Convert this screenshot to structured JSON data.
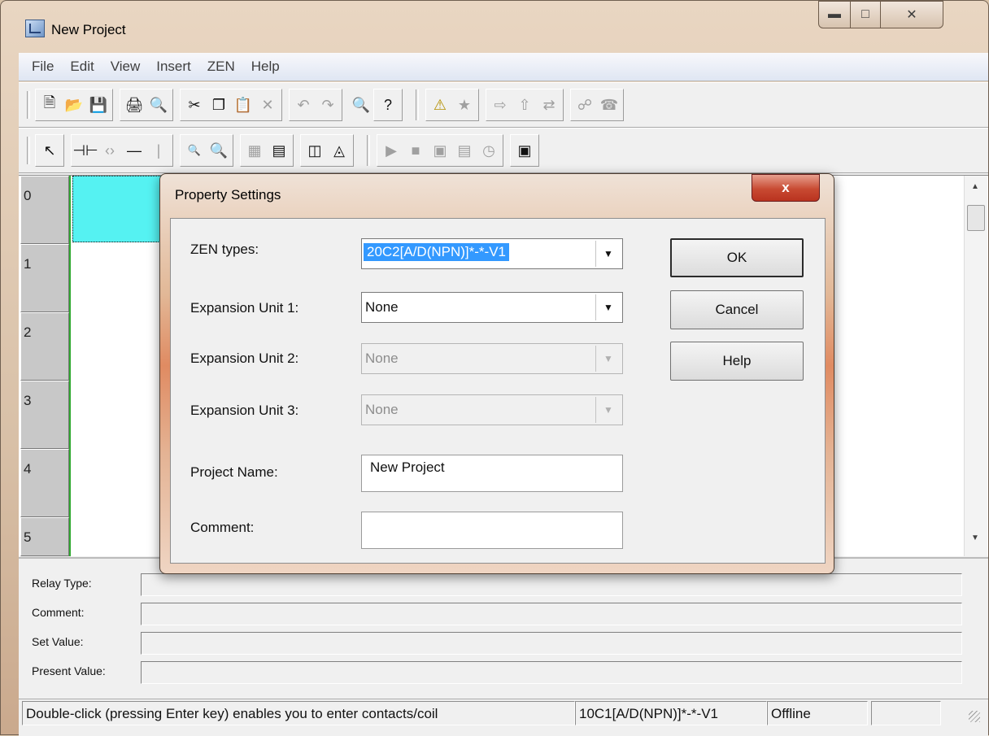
{
  "window": {
    "title": "New Project",
    "min_icon": "minimize-icon",
    "max_icon": "maximize-icon",
    "close_icon": "close-icon"
  },
  "menu": [
    "File",
    "Edit",
    "View",
    "Insert",
    "ZEN",
    "Help"
  ],
  "rows": [
    "0",
    "1",
    "2",
    "3",
    "4",
    "5"
  ],
  "info": {
    "relay_type": "Relay Type:",
    "comment": "Comment:",
    "set_value": "Set Value:",
    "present_value": "Present Value:"
  },
  "status": {
    "hint": "Double-click (pressing Enter key) enables you to enter contacts/coil",
    "type": "10C1[A/D(NPN)]*-*-V1",
    "mode": "Offline"
  },
  "dialog": {
    "title": "Property Settings",
    "close_label": "x",
    "zen_types_label": "ZEN types:",
    "zen_types_value": "20C2[A/D(NPN)]*-*-V1",
    "exp1_label": "Expansion Unit 1:",
    "exp1_value": "None",
    "exp2_label": "Expansion Unit 2:",
    "exp2_value": "None",
    "exp3_label": "Expansion Unit 3:",
    "exp3_value": "None",
    "project_name_label": "Project Name:",
    "project_name_value": "New Project",
    "comment_label": "Comment:",
    "comment_value": "",
    "ok_label": "OK",
    "cancel_label": "Cancel",
    "help_label": "Help"
  }
}
